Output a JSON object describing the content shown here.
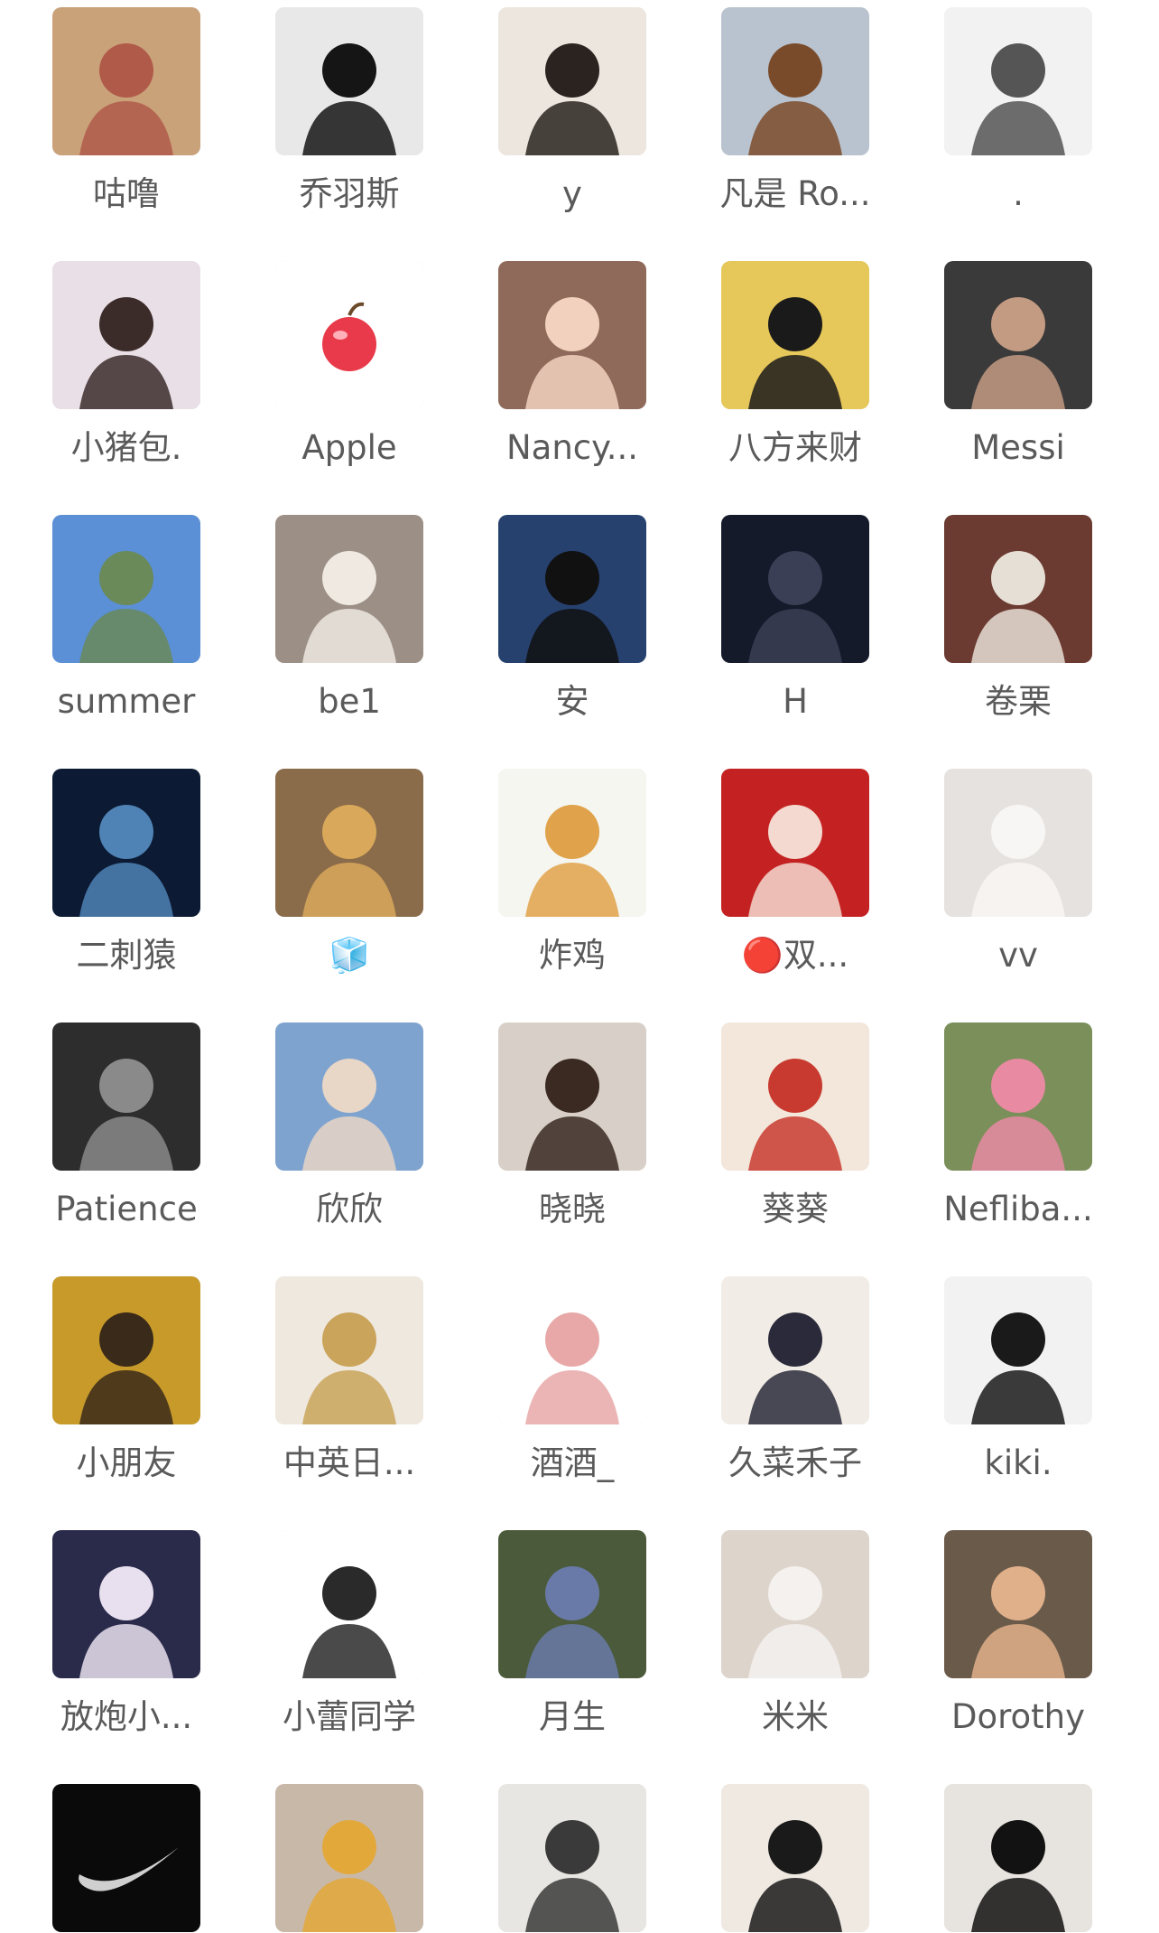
{
  "members": [
    {
      "name": "咕噜",
      "avatar": "cartoon-mouse-hearts-icon",
      "bg": "#c9a27a",
      "fg": "#b05a4a"
    },
    {
      "name": "乔羽斯",
      "avatar": "man-portrait-bw-icon",
      "bg": "#e8e8e8",
      "fg": "#151515"
    },
    {
      "name": "y",
      "avatar": "girl-back-hat-icon",
      "bg": "#ece6df",
      "fg": "#2a2320"
    },
    {
      "name": "凡是 Ro...",
      "avatar": "deer-statue-city-icon",
      "bg": "#b9c3cf",
      "fg": "#7a4b2a"
    },
    {
      "name": ".",
      "avatar": "manga-sketch-icon",
      "bg": "#f2f2f2",
      "fg": "#555555"
    },
    {
      "name": "小猪包.",
      "avatar": "girl-sunglasses-unicorn-icon",
      "bg": "#e9dfe6",
      "fg": "#3b2c2a"
    },
    {
      "name": "Apple",
      "avatar": "red-apple-icon",
      "bg": "#ffffff",
      "fg": "#e83a4a"
    },
    {
      "name": "Nancy...",
      "avatar": "girl-beanie-photo-icon",
      "bg": "#8f6a5a",
      "fg": "#f2d2bf"
    },
    {
      "name": "八方来财",
      "avatar": "black-cat-flowers-icon",
      "bg": "#e6c75a",
      "fg": "#1a1a1a"
    },
    {
      "name": "Messi",
      "avatar": "man-smiling-photo-icon",
      "bg": "#3a3a3a",
      "fg": "#c39b82"
    },
    {
      "name": "summer",
      "avatar": "mountain-landscape-icon",
      "bg": "#5b8fd6",
      "fg": "#6a8a5a"
    },
    {
      "name": "be1",
      "avatar": "fluffy-kitten-icon",
      "bg": "#9b8f86",
      "fg": "#efe9e2"
    },
    {
      "name": "安",
      "avatar": "anime-girl-black-hair-icon",
      "bg": "#27416f",
      "fg": "#111111"
    },
    {
      "name": "H",
      "avatar": "anime-boy-dark-icon",
      "bg": "#151a2a",
      "fg": "#3a3f55"
    },
    {
      "name": "卷栗",
      "avatar": "ragdoll-cat-roses-icon",
      "bg": "#6b3a30",
      "fg": "#e6dfd6"
    },
    {
      "name": "二刺猿",
      "avatar": "anime-night-car-icon",
      "bg": "#0c1a33",
      "fg": "#4f83b5"
    },
    {
      "name": "🧊",
      "avatar": "anime-girl-blonde-icon",
      "bg": "#8a6b4a",
      "fg": "#d9a85a"
    },
    {
      "name": "炸鸡",
      "avatar": "cartoon-chick-sticker-icon",
      "bg": "#f5f6f0",
      "fg": "#e0a24a"
    },
    {
      "name": "🔴双...",
      "avatar": "woman-red-background-icon",
      "bg": "#c42222",
      "fg": "#f3d9cf"
    },
    {
      "name": "vv",
      "avatar": "white-cat-closeup-icon",
      "bg": "#e6e2df",
      "fg": "#f8f6f4"
    },
    {
      "name": "Patience",
      "avatar": "tom-cat-piano-icon",
      "bg": "#2d2d2d",
      "fg": "#8a8a8a"
    },
    {
      "name": "欣欣",
      "avatar": "girl-sky-clouds-icon",
      "bg": "#7fa3cf",
      "fg": "#e8d6c6"
    },
    {
      "name": "晓晓",
      "avatar": "cartoon-girl-face-icon",
      "bg": "#d8d0c8",
      "fg": "#3a2a22"
    },
    {
      "name": "葵葵",
      "avatar": "anime-girl-red-hat-icon",
      "bg": "#f3e6da",
      "fg": "#c83a2f"
    },
    {
      "name": "Nefliba...",
      "avatar": "girl-pink-flowers-icon",
      "bg": "#7a8f5a",
      "fg": "#e88aa2"
    },
    {
      "name": "小朋友",
      "avatar": "girl-sunflowers-icon",
      "bg": "#c79a2a",
      "fg": "#3a2a1a"
    },
    {
      "name": "中英日...",
      "avatar": "woman-gold-dress-icon",
      "bg": "#efe8df",
      "fg": "#c9a45a"
    },
    {
      "name": "酒酒_",
      "avatar": "cartoon-rabbit-icon",
      "bg": "#ffffff",
      "fg": "#e8a8a8"
    },
    {
      "name": "久菜禾子",
      "avatar": "anime-girl-hanfu-icon",
      "bg": "#f2ece6",
      "fg": "#2a2a3a"
    },
    {
      "name": "kiki.",
      "avatar": "woman-bw-portrait-icon",
      "bg": "#f2f2f2",
      "fg": "#1a1a1a"
    },
    {
      "name": "放炮小...",
      "avatar": "girl-white-hair-icon",
      "bg": "#2a2a4a",
      "fg": "#e8e0ef"
    },
    {
      "name": "小蕾同学",
      "avatar": "cartoon-girl-cat-hat-icon",
      "bg": "#ffffff",
      "fg": "#2a2a2a"
    },
    {
      "name": "月生",
      "avatar": "girl-flower-field-icon",
      "bg": "#4a5a3a",
      "fg": "#6a7aa8"
    },
    {
      "name": "米米",
      "avatar": "girl-white-dog-icon",
      "bg": "#ddd4cc",
      "fg": "#f4f1ee"
    },
    {
      "name": "Dorothy",
      "avatar": "girl-glasses-bear-icon",
      "bg": "#6a5a4a",
      "fg": "#e0b08a"
    },
    {
      "name": "",
      "avatar": "nike-swoosh-icon",
      "bg": "#0a0a0a",
      "fg": "#cfcfcf"
    },
    {
      "name": "",
      "avatar": "girl-beer-hat-icon",
      "bg": "#c8b8a8",
      "fg": "#e3a83a"
    },
    {
      "name": "",
      "avatar": "woman-office-desk-icon",
      "bg": "#e8e6e2",
      "fg": "#3a3a3a"
    },
    {
      "name": "",
      "avatar": "woman-blonde-black-dress-icon",
      "bg": "#efe9e2",
      "fg": "#1a1a1a"
    },
    {
      "name": "",
      "avatar": "woman-black-portrait-icon",
      "bg": "#e7e3de",
      "fg": "#121212"
    }
  ]
}
